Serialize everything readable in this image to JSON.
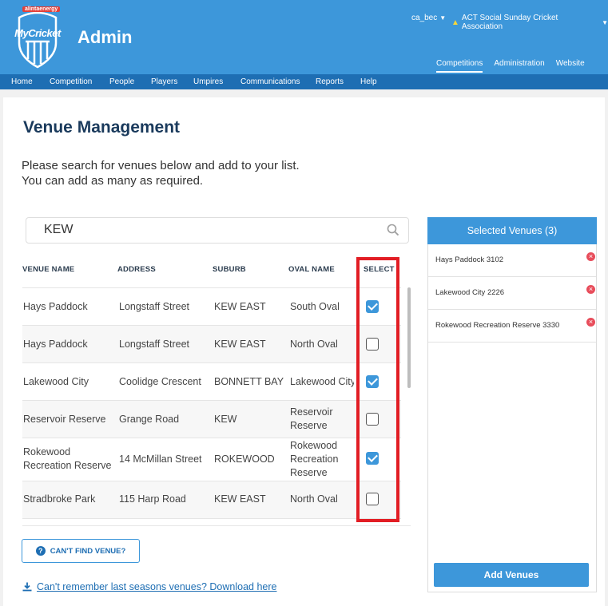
{
  "header": {
    "sponsor": "alintaenergy",
    "brand": "MyCricket",
    "admin_title": "Admin",
    "user": "ca_bec",
    "association": "ACT Social Sunday Cricket Association",
    "top_links": [
      "Competitions",
      "Administration",
      "Website"
    ]
  },
  "nav": [
    "Home",
    "Competition",
    "People",
    "Players",
    "Umpires",
    "Communications",
    "Reports",
    "Help"
  ],
  "page": {
    "title": "Venue Management",
    "intro_line1": "Please search for venues below and add to your list.",
    "intro_line2": "You can add as many as required."
  },
  "search": {
    "value": "KEW",
    "placeholder": ""
  },
  "table": {
    "headers": [
      "VENUE NAME",
      "ADDRESS",
      "SUBURB",
      "OVAL NAME",
      "SELECT"
    ],
    "rows": [
      {
        "venue": "Hays Paddock",
        "venue2": "",
        "address": "Longstaff Street",
        "suburb": "KEW EAST",
        "oval": "South Oval",
        "oval2": "",
        "oval3": "",
        "checked": true
      },
      {
        "venue": "Hays Paddock",
        "venue2": "",
        "address": "Longstaff Street",
        "suburb": "KEW EAST",
        "oval": "North Oval",
        "oval2": "",
        "oval3": "",
        "checked": false
      },
      {
        "venue": "Lakewood City",
        "venue2": "",
        "address": "Coolidge Crescent",
        "suburb": "BONNETT BAY",
        "oval": "Lakewood City",
        "oval2": "",
        "oval3": "",
        "checked": true
      },
      {
        "venue": "Reservoir Reserve",
        "venue2": "",
        "address": "Grange Road",
        "suburb": "KEW",
        "oval": "Reservoir",
        "oval2": "Reserve",
        "oval3": "",
        "checked": false
      },
      {
        "venue": "Rokewood",
        "venue2": "Recreation Reserve",
        "address": "14 McMillan Street",
        "suburb": "ROKEWOOD",
        "oval": "Rokewood",
        "oval2": "Recreation",
        "oval3": "Reserve",
        "checked": true
      },
      {
        "venue": "Stradbroke Park",
        "venue2": "",
        "address": "115 Harp Road",
        "suburb": "KEW EAST",
        "oval": "North Oval",
        "oval2": "",
        "oval3": "",
        "checked": false
      }
    ]
  },
  "cant_find_label": "CAN'T FIND VENUE?",
  "download_label": "Can't remember last seasons venues? Download here",
  "selected": {
    "header": "Selected Venues (3)",
    "items": [
      "Hays Paddock 3102",
      "Lakewood City 2226",
      "Rokewood Recreation Reserve 3330"
    ],
    "add_label": "Add Venues"
  },
  "colors": {
    "primary": "#3d97da",
    "nav": "#1e6eb3",
    "highlight": "#e21d24",
    "title": "#1a3a5c"
  }
}
